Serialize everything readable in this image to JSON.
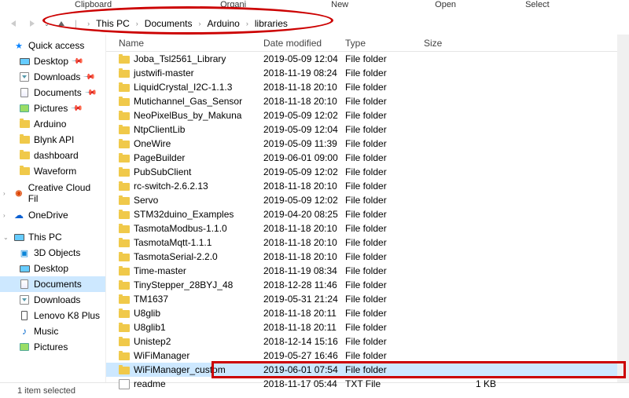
{
  "ribbon": {
    "clipboard": "Clipboard",
    "organize": "Organi",
    "new": "New",
    "open": "Open",
    "select": "Select"
  },
  "breadcrumbs": [
    "This PC",
    "Documents",
    "Arduino",
    "libraries"
  ],
  "nav": {
    "quick": "Quick access",
    "desktop": "Desktop",
    "downloads": "Downloads",
    "documents": "Documents",
    "pictures": "Pictures",
    "arduino": "Arduino",
    "blynk": "Blynk API",
    "dashboard": "dashboard",
    "waveform": "Waveform",
    "cc": "Creative Cloud Fil",
    "onedrive": "OneDrive",
    "thispc": "This PC",
    "objects": "3D Objects",
    "desktop2": "Desktop",
    "documents2": "Documents",
    "downloads2": "Downloads",
    "lenovo": "Lenovo K8 Plus",
    "music": "Music",
    "pictures2": "Pictures"
  },
  "headers": {
    "name": "Name",
    "date": "Date modified",
    "type": "Type",
    "size": "Size"
  },
  "files": [
    {
      "name": "Joba_Tsl2561_Library",
      "date": "2019-05-09 12:04",
      "type": "File folder",
      "size": "",
      "k": "f"
    },
    {
      "name": "justwifi-master",
      "date": "2018-11-19 08:24",
      "type": "File folder",
      "size": "",
      "k": "f"
    },
    {
      "name": "LiquidCrystal_I2C-1.1.3",
      "date": "2018-11-18 20:10",
      "type": "File folder",
      "size": "",
      "k": "f"
    },
    {
      "name": "Mutichannel_Gas_Sensor",
      "date": "2018-11-18 20:10",
      "type": "File folder",
      "size": "",
      "k": "f"
    },
    {
      "name": "NeoPixelBus_by_Makuna",
      "date": "2019-05-09 12:02",
      "type": "File folder",
      "size": "",
      "k": "f"
    },
    {
      "name": "NtpClientLib",
      "date": "2019-05-09 12:04",
      "type": "File folder",
      "size": "",
      "k": "f"
    },
    {
      "name": "OneWire",
      "date": "2019-05-09 11:39",
      "type": "File folder",
      "size": "",
      "k": "f"
    },
    {
      "name": "PageBuilder",
      "date": "2019-06-01 09:00",
      "type": "File folder",
      "size": "",
      "k": "f"
    },
    {
      "name": "PubSubClient",
      "date": "2019-05-09 12:02",
      "type": "File folder",
      "size": "",
      "k": "f"
    },
    {
      "name": "rc-switch-2.6.2.13",
      "date": "2018-11-18 20:10",
      "type": "File folder",
      "size": "",
      "k": "f"
    },
    {
      "name": "Servo",
      "date": "2019-05-09 12:02",
      "type": "File folder",
      "size": "",
      "k": "f"
    },
    {
      "name": "STM32duino_Examples",
      "date": "2019-04-20 08:25",
      "type": "File folder",
      "size": "",
      "k": "f"
    },
    {
      "name": "TasmotaModbus-1.1.0",
      "date": "2018-11-18 20:10",
      "type": "File folder",
      "size": "",
      "k": "f"
    },
    {
      "name": "TasmotaMqtt-1.1.1",
      "date": "2018-11-18 20:10",
      "type": "File folder",
      "size": "",
      "k": "f"
    },
    {
      "name": "TasmotaSerial-2.2.0",
      "date": "2018-11-18 20:10",
      "type": "File folder",
      "size": "",
      "k": "f"
    },
    {
      "name": "Time-master",
      "date": "2018-11-19 08:34",
      "type": "File folder",
      "size": "",
      "k": "f"
    },
    {
      "name": "TinyStepper_28BYJ_48",
      "date": "2018-12-28 11:46",
      "type": "File folder",
      "size": "",
      "k": "f"
    },
    {
      "name": "TM1637",
      "date": "2019-05-31 21:24",
      "type": "File folder",
      "size": "",
      "k": "f"
    },
    {
      "name": "U8glib",
      "date": "2018-11-18 20:11",
      "type": "File folder",
      "size": "",
      "k": "f"
    },
    {
      "name": "U8glib1",
      "date": "2018-11-18 20:11",
      "type": "File folder",
      "size": "",
      "k": "f"
    },
    {
      "name": "Unistep2",
      "date": "2018-12-14 15:16",
      "type": "File folder",
      "size": "",
      "k": "f"
    },
    {
      "name": "WiFiManager",
      "date": "2019-05-27 16:46",
      "type": "File folder",
      "size": "",
      "k": "f"
    },
    {
      "name": "WiFiManager_custom",
      "date": "2019-06-01 07:54",
      "type": "File folder",
      "size": "",
      "k": "f",
      "sel": true
    },
    {
      "name": "readme",
      "date": "2018-11-17 05:44",
      "type": "TXT File",
      "size": "1 KB",
      "k": "t"
    }
  ],
  "status": {
    "count": "",
    "sel": "1 item selected"
  }
}
